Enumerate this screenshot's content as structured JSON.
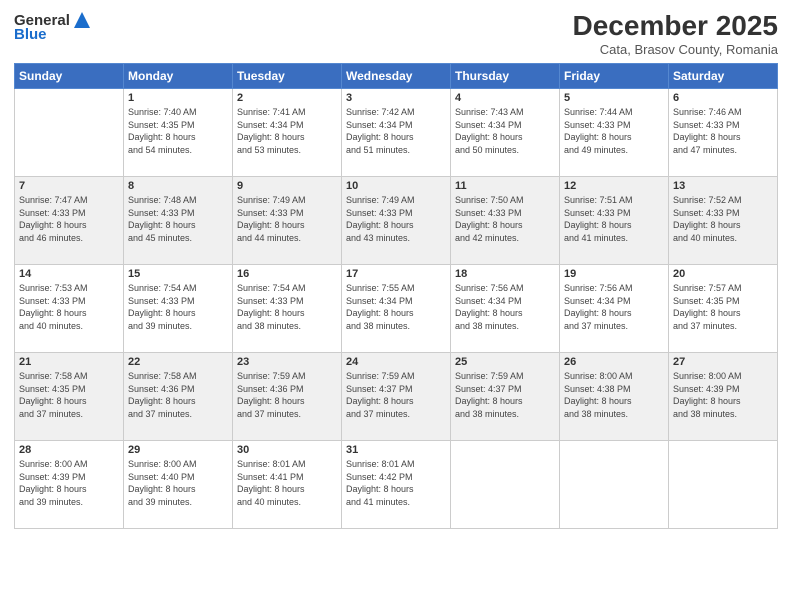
{
  "header": {
    "logo_general": "General",
    "logo_blue": "Blue",
    "month_title": "December 2025",
    "location": "Cata, Brasov County, Romania"
  },
  "weekdays": [
    "Sunday",
    "Monday",
    "Tuesday",
    "Wednesday",
    "Thursday",
    "Friday",
    "Saturday"
  ],
  "weeks": [
    [
      {
        "day": "",
        "info": ""
      },
      {
        "day": "1",
        "info": "Sunrise: 7:40 AM\nSunset: 4:35 PM\nDaylight: 8 hours\nand 54 minutes."
      },
      {
        "day": "2",
        "info": "Sunrise: 7:41 AM\nSunset: 4:34 PM\nDaylight: 8 hours\nand 53 minutes."
      },
      {
        "day": "3",
        "info": "Sunrise: 7:42 AM\nSunset: 4:34 PM\nDaylight: 8 hours\nand 51 minutes."
      },
      {
        "day": "4",
        "info": "Sunrise: 7:43 AM\nSunset: 4:34 PM\nDaylight: 8 hours\nand 50 minutes."
      },
      {
        "day": "5",
        "info": "Sunrise: 7:44 AM\nSunset: 4:33 PM\nDaylight: 8 hours\nand 49 minutes."
      },
      {
        "day": "6",
        "info": "Sunrise: 7:46 AM\nSunset: 4:33 PM\nDaylight: 8 hours\nand 47 minutes."
      }
    ],
    [
      {
        "day": "7",
        "info": "Sunrise: 7:47 AM\nSunset: 4:33 PM\nDaylight: 8 hours\nand 46 minutes."
      },
      {
        "day": "8",
        "info": "Sunrise: 7:48 AM\nSunset: 4:33 PM\nDaylight: 8 hours\nand 45 minutes."
      },
      {
        "day": "9",
        "info": "Sunrise: 7:49 AM\nSunset: 4:33 PM\nDaylight: 8 hours\nand 44 minutes."
      },
      {
        "day": "10",
        "info": "Sunrise: 7:49 AM\nSunset: 4:33 PM\nDaylight: 8 hours\nand 43 minutes."
      },
      {
        "day": "11",
        "info": "Sunrise: 7:50 AM\nSunset: 4:33 PM\nDaylight: 8 hours\nand 42 minutes."
      },
      {
        "day": "12",
        "info": "Sunrise: 7:51 AM\nSunset: 4:33 PM\nDaylight: 8 hours\nand 41 minutes."
      },
      {
        "day": "13",
        "info": "Sunrise: 7:52 AM\nSunset: 4:33 PM\nDaylight: 8 hours\nand 40 minutes."
      }
    ],
    [
      {
        "day": "14",
        "info": "Sunrise: 7:53 AM\nSunset: 4:33 PM\nDaylight: 8 hours\nand 40 minutes."
      },
      {
        "day": "15",
        "info": "Sunrise: 7:54 AM\nSunset: 4:33 PM\nDaylight: 8 hours\nand 39 minutes."
      },
      {
        "day": "16",
        "info": "Sunrise: 7:54 AM\nSunset: 4:33 PM\nDaylight: 8 hours\nand 38 minutes."
      },
      {
        "day": "17",
        "info": "Sunrise: 7:55 AM\nSunset: 4:34 PM\nDaylight: 8 hours\nand 38 minutes."
      },
      {
        "day": "18",
        "info": "Sunrise: 7:56 AM\nSunset: 4:34 PM\nDaylight: 8 hours\nand 38 minutes."
      },
      {
        "day": "19",
        "info": "Sunrise: 7:56 AM\nSunset: 4:34 PM\nDaylight: 8 hours\nand 37 minutes."
      },
      {
        "day": "20",
        "info": "Sunrise: 7:57 AM\nSunset: 4:35 PM\nDaylight: 8 hours\nand 37 minutes."
      }
    ],
    [
      {
        "day": "21",
        "info": "Sunrise: 7:58 AM\nSunset: 4:35 PM\nDaylight: 8 hours\nand 37 minutes."
      },
      {
        "day": "22",
        "info": "Sunrise: 7:58 AM\nSunset: 4:36 PM\nDaylight: 8 hours\nand 37 minutes."
      },
      {
        "day": "23",
        "info": "Sunrise: 7:59 AM\nSunset: 4:36 PM\nDaylight: 8 hours\nand 37 minutes."
      },
      {
        "day": "24",
        "info": "Sunrise: 7:59 AM\nSunset: 4:37 PM\nDaylight: 8 hours\nand 37 minutes."
      },
      {
        "day": "25",
        "info": "Sunrise: 7:59 AM\nSunset: 4:37 PM\nDaylight: 8 hours\nand 38 minutes."
      },
      {
        "day": "26",
        "info": "Sunrise: 8:00 AM\nSunset: 4:38 PM\nDaylight: 8 hours\nand 38 minutes."
      },
      {
        "day": "27",
        "info": "Sunrise: 8:00 AM\nSunset: 4:39 PM\nDaylight: 8 hours\nand 38 minutes."
      }
    ],
    [
      {
        "day": "28",
        "info": "Sunrise: 8:00 AM\nSunset: 4:39 PM\nDaylight: 8 hours\nand 39 minutes."
      },
      {
        "day": "29",
        "info": "Sunrise: 8:00 AM\nSunset: 4:40 PM\nDaylight: 8 hours\nand 39 minutes."
      },
      {
        "day": "30",
        "info": "Sunrise: 8:01 AM\nSunset: 4:41 PM\nDaylight: 8 hours\nand 40 minutes."
      },
      {
        "day": "31",
        "info": "Sunrise: 8:01 AM\nSunset: 4:42 PM\nDaylight: 8 hours\nand 41 minutes."
      },
      {
        "day": "",
        "info": ""
      },
      {
        "day": "",
        "info": ""
      },
      {
        "day": "",
        "info": ""
      }
    ]
  ]
}
